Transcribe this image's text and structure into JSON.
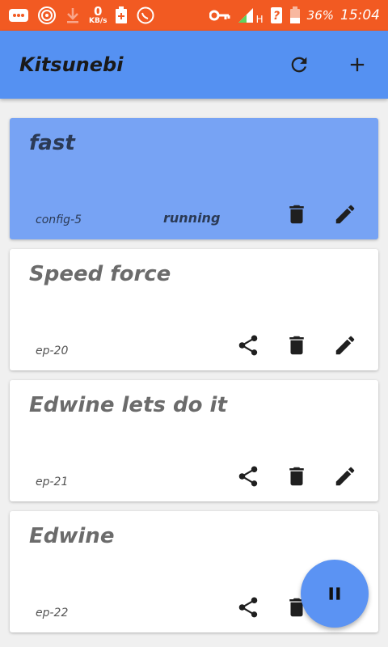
{
  "statusbar": {
    "speed_value": "0",
    "speed_unit": "KB/s",
    "network": "H",
    "battery": "36%",
    "time": "15:04",
    "color": "#f25a22"
  },
  "appbar": {
    "title": "Kitsunebi",
    "refresh_icon": "refresh-icon",
    "add_icon": "add-icon",
    "color": "#5591f2"
  },
  "cards": [
    {
      "title": "fast",
      "tag": "config-5",
      "status": "running",
      "active": true
    },
    {
      "title": "Speed force",
      "tag": "ep-20",
      "status": "",
      "active": false
    },
    {
      "title": "Edwine lets do it",
      "tag": "ep-21",
      "status": "",
      "active": false
    },
    {
      "title": "Edwine",
      "tag": "ep-22",
      "status": "",
      "active": false
    }
  ],
  "fab": {
    "icon": "pause-icon",
    "color": "#5b93f3"
  }
}
